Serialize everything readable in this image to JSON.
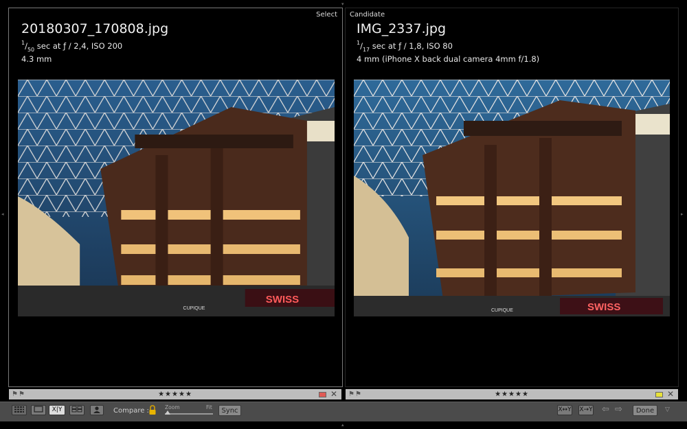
{
  "left_pane": {
    "label": "Select",
    "filename": "20180307_170808.jpg",
    "shutter_num": "1",
    "shutter_den": "50",
    "exposure_rest": " sec at ƒ / 2,4, ISO 200",
    "focal": "4.3 mm",
    "rating": "★★★★★",
    "color_label": "#e05a55"
  },
  "right_pane": {
    "label": "Candidate",
    "filename": "IMG_2337.jpg",
    "shutter_num": "1",
    "shutter_den": "17",
    "exposure_rest": " sec at ƒ / 1,8, ISO 80",
    "focal": "4 mm (iPhone X back dual camera 4mm f/1.8)",
    "rating": "★★★★★",
    "color_label": "#e7e13a"
  },
  "photo_text": {
    "sign": "SWISS",
    "store": "CUPIQUE"
  },
  "toolbar": {
    "compare_label": "Compare :",
    "zoom_label": "Zoom",
    "fit_label": "Fit",
    "sync_label": "Sync",
    "done_label": "Done",
    "xy_label": "X|Y",
    "swap_left_label": "X↔Y",
    "swap_right_label": "X→Y"
  },
  "icons": {
    "grid": "grid-view-icon",
    "loupe": "loupe-view-icon",
    "compare": "compare-view-icon",
    "survey": "survey-view-icon",
    "people": "people-view-icon",
    "lock": "lock-icon",
    "flag": "flag-icon",
    "close": "close-icon",
    "left_arrow": "left-arrow-icon",
    "right_arrow": "right-arrow-icon"
  }
}
